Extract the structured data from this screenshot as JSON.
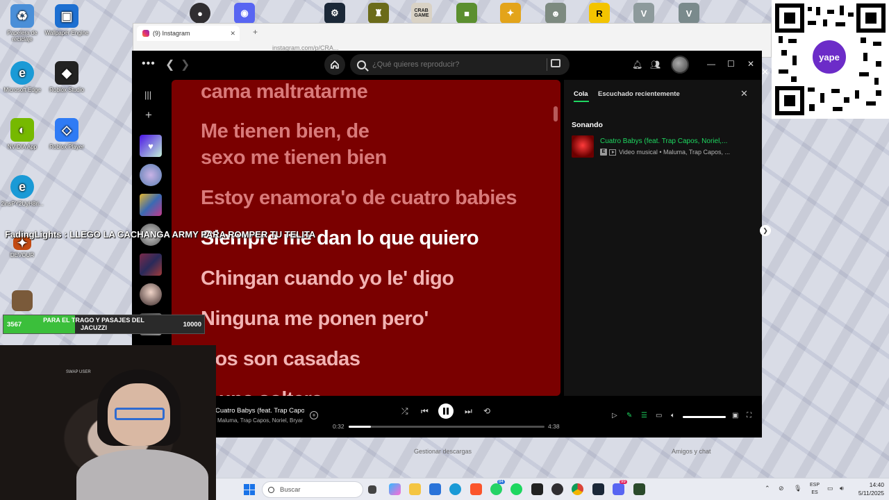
{
  "desktop": {
    "icons": [
      {
        "label": "Papelera de reciclaje",
        "color": "#4a8fd8",
        "icon": "recycle-bin-icon"
      },
      {
        "label": "Wallpaper Engine",
        "color": "#1d6fd1",
        "icon": "wallpaper-engine-icon"
      },
      {
        "label": "Microsoft Edge",
        "color": "#1a9ad6",
        "icon": "edge-icon"
      },
      {
        "label": "Roblox Studio",
        "color": "#222222",
        "icon": "roblox-studio-icon"
      },
      {
        "label": "NVIDIA App",
        "color": "#76b900",
        "icon": "nvidia-icon"
      },
      {
        "label": "Roblox Player",
        "color": "#2f7bf5",
        "icon": "roblox-player-icon"
      },
      {
        "label": "2insPY2UyH8ri...",
        "color": "#1a9ad6",
        "icon": "edge-shortcut-icon"
      },
      {
        "label": "DEVOUR",
        "color": "#c24a12",
        "icon": "devour-icon"
      }
    ]
  },
  "browser": {
    "tab_title": "(9) Instagram",
    "url": "instagram.com/p/CRA..."
  },
  "spotify": {
    "search_placeholder": "¿Qué quieres reproducir?",
    "lyrics": {
      "past": [
        "cama maltratarme",
        "Me tienen bien, de",
        "sexo me tienen bien",
        "Estoy enamora'o de cuatro babies"
      ],
      "current": "Siempre me dan lo que quiero",
      "upcoming": [
        "Chingan cuando yo le' digo",
        "Ninguna me ponen pero'",
        "Dos son casadas",
        "Y una soltera"
      ]
    },
    "queue": {
      "tab_queue": "Cola",
      "tab_recent": "Escuchado recientemente",
      "now_playing_heading": "Sonando",
      "track_title": "Cuatro Babys (feat. Trap Capos, Noriel,...",
      "track_meta": "Video musical • Maluma, Trap Capos, ..."
    },
    "player": {
      "track": "Cuatro Babys (feat. Trap Capos, Noriel, Bryant",
      "artist": "Maluma, Trap Capos, Noriel, Bryant",
      "elapsed": "0:32",
      "total": "4:38",
      "progress": 0.115,
      "volume": 1.0
    },
    "footer": {
      "downloads": "Gestionar descargas",
      "friends": "Amigos y chat"
    },
    "colors": {
      "accent": "#1ed760",
      "lyrics_bg": "#7a0000"
    }
  },
  "stream": {
    "chat_user": "FadingLights",
    "chat_message": "LLEGO LA CACHANGA ARMY PARA ROMPER TU TELITA",
    "goal_current": "3567",
    "goal_label": "PARA EL TRAGO Y PASAJES DEL JACUZZI",
    "goal_target": "10000",
    "goal_progress": 0.3567,
    "webcam_label": "SWAP USER"
  },
  "qr": {
    "brand": "yape"
  },
  "taskbar": {
    "search_placeholder": "Buscar",
    "language_top": "ESP",
    "language_bottom": "ES",
    "time": "14:40",
    "date": "5/11/2025",
    "badges": {
      "whatsapp": "84",
      "discord": "99"
    }
  }
}
